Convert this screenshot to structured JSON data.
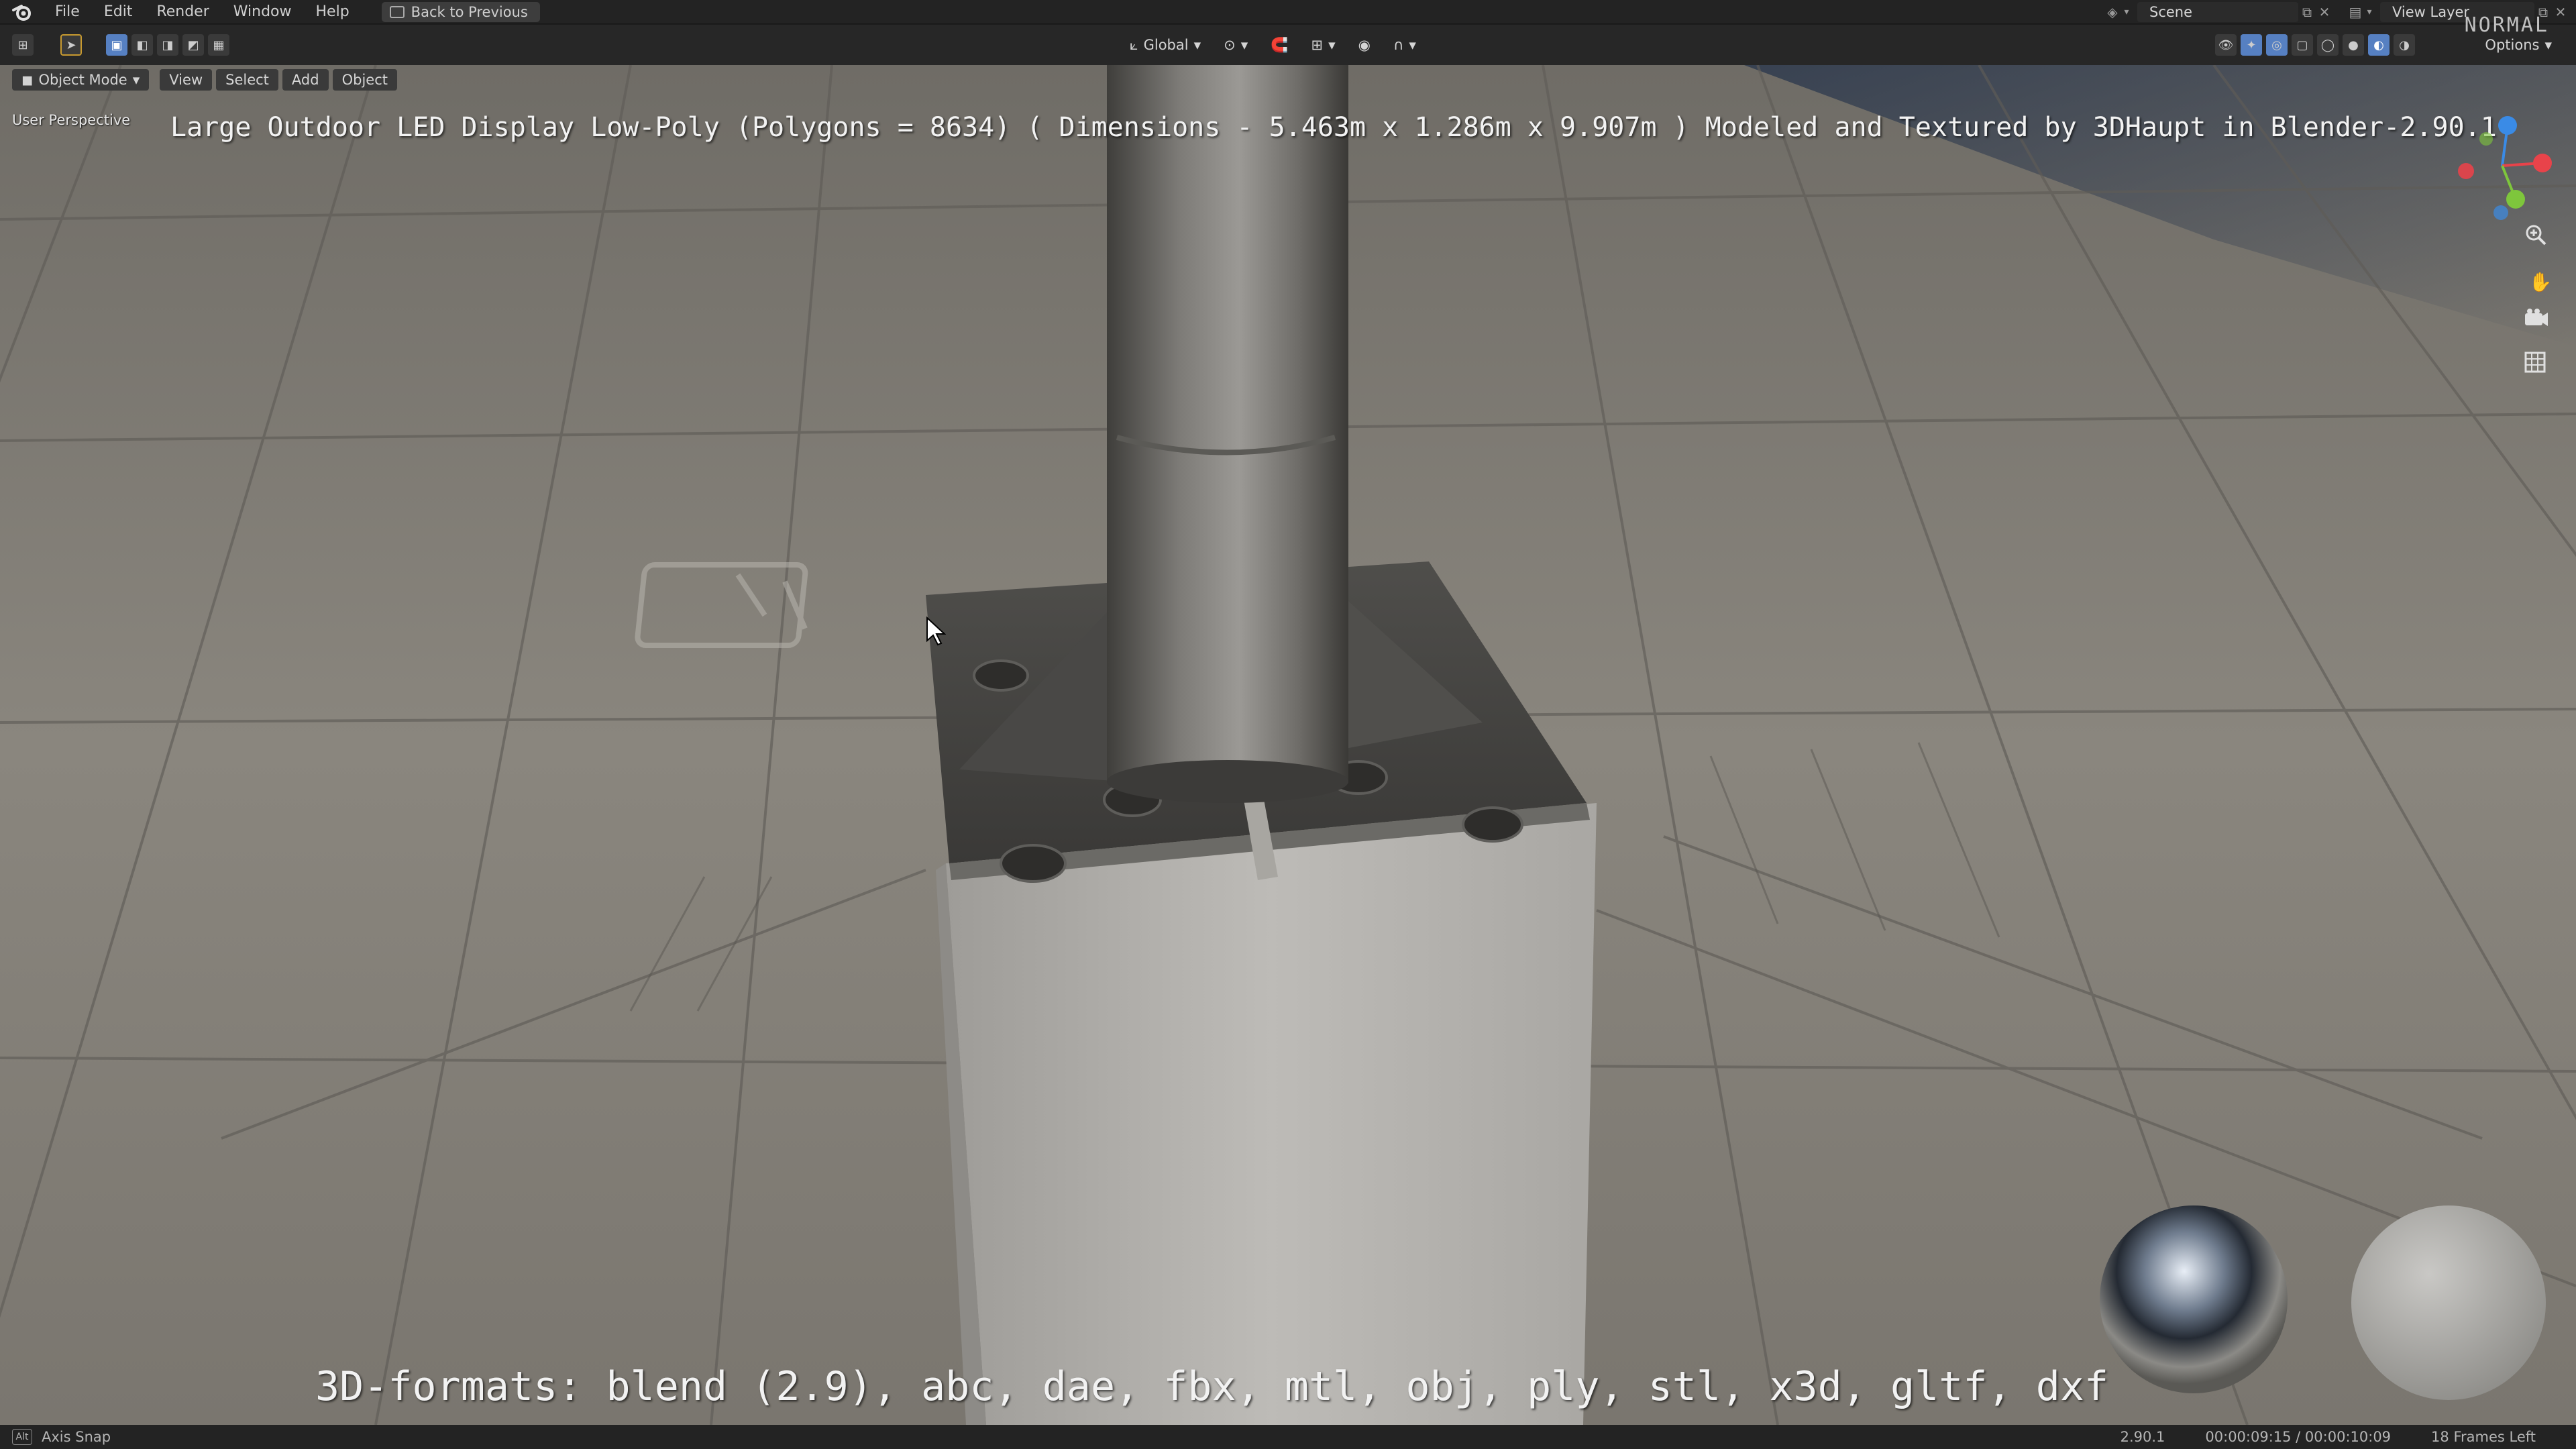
{
  "menu": {
    "items": [
      "File",
      "Edit",
      "Render",
      "Window",
      "Help"
    ],
    "back_button": "Back to Previous"
  },
  "top_right": {
    "scene_label": "Scene",
    "view_layer_label": "View Layer",
    "options_label": "Options",
    "watermark": "NORMAL"
  },
  "header": {
    "transform_orientation": "Global",
    "mode": "Object Mode",
    "view": "View",
    "select": "Select",
    "add": "Add",
    "object": "Object"
  },
  "viewport": {
    "perspective_label": "User Perspective",
    "title_overlay": "Large Outdoor LED Display Low-Poly (Polygons = 8634) ( Dimensions -  5.463m x 1.286m x 9.907m ) Modeled and Textured by 3DHaupt in Blender-2.90.1",
    "formats_overlay": "3D-formats: blend (2.9), abc, dae, fbx, mtl, obj, ply, stl, x3d, gltf, dxf",
    "gizmo": {
      "x": "X",
      "y": "Y",
      "z": "Z"
    }
  },
  "icons": {
    "zoom": "zoom-icon",
    "pan": "hand-icon",
    "camera": "camera-icon",
    "grid": "grid-icon"
  },
  "status": {
    "snap_key": "Alt",
    "snap_label": "Axis Snap",
    "version": "2.90.1",
    "time": "00:00:09:15 / 00:00:10:09",
    "frames_left": "18 Frames Left"
  },
  "colors": {
    "accent": "#5680c2",
    "axis_x": "#e8434a",
    "axis_y": "#7ec63c",
    "axis_z": "#3a8be6"
  }
}
